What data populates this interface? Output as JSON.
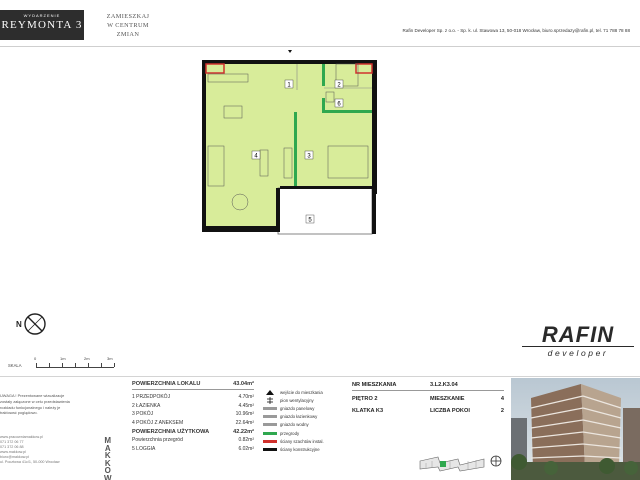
{
  "header": {
    "logo_small": "WYDARZENIE",
    "logo_main": "REYMONTA 3",
    "slogan": [
      "ZAMIESZKAJ",
      "W CENTRUM",
      "ZMIAN"
    ],
    "contact": "Rafin Developer Sp. z o.o. - Sp. k. ul. Stawowa 13, 50-018 Wrocław, biuro.sprzedazy@rafin.pl, tel. 71 788 78 88"
  },
  "plan": {
    "room_numbers": [
      "1",
      "2",
      "3",
      "4",
      "5",
      "6"
    ],
    "wall_color": "#111111",
    "room_fill": "#d8ec9a",
    "partition_color": "#2fa84f"
  },
  "scale": {
    "label": "SKALA",
    "ticks": [
      "0",
      "1m",
      "2m",
      "3m"
    ]
  },
  "brand": {
    "word": "RAFIN",
    "sub": "developer"
  },
  "note": {
    "text": "UWAGA ! Prezentowane wizualizacje zostały załączone w celu przedstawienia rozkładu funkcjonalnego i należy je traktować poglądowo."
  },
  "contacts": {
    "lines": [
      "www.pracowniamakkow.pl",
      "071 372 06 77",
      "071 372 06 88",
      "www.makkow.pl",
      "biuro@makkow.pl",
      "ul. Pocztowa 41c/1, 50-000 Wrocław"
    ]
  },
  "designer": {
    "letters": [
      "M",
      "A",
      "K",
      "K",
      "O",
      "W"
    ]
  },
  "areas": {
    "total_label": "POWIERZCHNIA LOKALU",
    "total_value": "43.04m²",
    "rows": [
      {
        "label": "1 PRZEDPOKÓJ",
        "value": "4.70m²",
        "bold": false
      },
      {
        "label": "2 ŁAZIENKA",
        "value": "4.45m²",
        "bold": false
      },
      {
        "label": "3 POKÓJ",
        "value": "10.96m²",
        "bold": false
      },
      {
        "label": "4 POKÓJ Z ANEKSEM",
        "value": "22.64m²",
        "bold": false
      },
      {
        "label": "POWIERZCHNIA UŻYTKOWA",
        "value": "42.22m²",
        "bold": true
      },
      {
        "label": "Powierzchnia przegród",
        "value": "0.82m²",
        "bold": false
      },
      {
        "label": "5 LOGGIA",
        "value": "6.02m²",
        "bold": false
      }
    ]
  },
  "legend": {
    "items": [
      {
        "label": "wejście do mieszkania",
        "kind": "arrow"
      },
      {
        "label": "pion wentylacyjny",
        "kind": "vent"
      },
      {
        "label": "gniazdo panelowy",
        "kind": "line-gray"
      },
      {
        "label": "gniazdo łazienkowy",
        "kind": "line-gray"
      },
      {
        "label": "gniazdo wodny",
        "kind": "line-gray"
      },
      {
        "label": "przegrody",
        "kind": "line-green"
      },
      {
        "label": "ściany szachtów instal.",
        "kind": "line-red"
      },
      {
        "label": "ściany konstrukcyjne",
        "kind": "line-black"
      }
    ],
    "colors": {
      "green": "#2fa84f",
      "red": "#d0312d",
      "gray": "#9a9a9a",
      "black": "#111111"
    }
  },
  "info": {
    "nr_label": "NR MIESZKANIA",
    "nr_value": "3.L2.K3.04",
    "floor_label": "PIĘTRO 2",
    "apt_label": "MIESZKANIE",
    "apt_value": "4",
    "stair_label": "KLATKA K3",
    "rooms_label": "LICZBA POKOI",
    "rooms_value": "2"
  }
}
